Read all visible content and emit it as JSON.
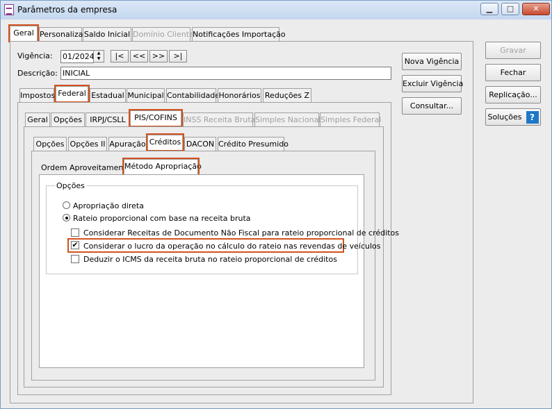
{
  "window": {
    "title": "Parâmetros da empresa",
    "min_icon": "minimize-icon",
    "max_icon": "maximize-icon",
    "close_icon": "close-icon",
    "accent": "#d2521e"
  },
  "top_tabs": [
    "Geral",
    "Personaliza",
    "Saldo Inicial",
    "Domínio Cliente",
    "Notificações Importação"
  ],
  "form": {
    "vigencia_label": "Vigência:",
    "vigencia_value": "01/2024",
    "nav": [
      "|<",
      "<<",
      ">>",
      ">|"
    ],
    "descricao_label": "Descrição:",
    "descricao_value": "INICIAL"
  },
  "mid_buttons": [
    "Nova Vigência",
    "Excluir Vigência",
    "Consultar..."
  ],
  "right_buttons": {
    "gravar": "Gravar",
    "fechar": "Fechar",
    "replicacao": "Replicação...",
    "solucoes": "Soluções",
    "help_glyph": "?"
  },
  "level2_tabs": [
    "Impostos",
    "Federal",
    "Estadual",
    "Municipal",
    "Contabilidade",
    "Honorários",
    "Reduções Z"
  ],
  "level3_tabs": [
    "Geral",
    "Opções",
    "IRPJ/CSLL",
    "PIS/COFINS",
    "INSS Receita Bruta",
    "Simples Nacional",
    "Simples Federal"
  ],
  "level4_tabs": [
    "Opções",
    "Opções II",
    "Apuração",
    "Créditos",
    "DACON",
    "Crédito Presumido"
  ],
  "level5_tabs": [
    "Ordem Aproveitamento",
    "Método Apropriação"
  ],
  "options": {
    "group_label": "Opções",
    "radio_direta": "Apropriação direta",
    "radio_rateio": "Rateio proporcional com base na receita bruta",
    "check_1": "Considerar Receitas de Documento Não Fiscal para rateio proporcional de créditos",
    "check_2": "Considerar o lucro da operação no cálculo do rateio nas revendas de veículos",
    "check_3": "Deduzir o ICMS da receita bruta no rateio proporcional de créditos",
    "check_mark": "✔"
  }
}
